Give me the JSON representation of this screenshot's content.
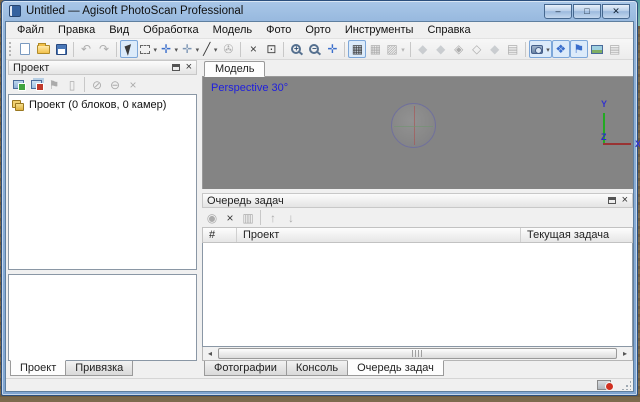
{
  "window": {
    "title": "Untitled — Agisoft PhotoScan Professional",
    "controls": {
      "minimize": "–",
      "maximize": "□",
      "close": "✕"
    }
  },
  "menu": {
    "items": [
      {
        "name": "menu-file",
        "label": "Файл"
      },
      {
        "name": "menu-edit",
        "label": "Правка"
      },
      {
        "name": "menu-view",
        "label": "Вид"
      },
      {
        "name": "menu-workflow",
        "label": "Обработка"
      },
      {
        "name": "menu-model",
        "label": "Модель"
      },
      {
        "name": "menu-photo",
        "label": "Фото"
      },
      {
        "name": "menu-ortho",
        "label": "Орто"
      },
      {
        "name": "menu-tools",
        "label": "Инструменты"
      },
      {
        "name": "menu-help",
        "label": "Справка"
      }
    ]
  },
  "toolbar": {
    "items": [
      {
        "name": "new-button",
        "icon": "new-document-icon",
        "cls": "i-page",
        "interactable": true
      },
      {
        "name": "open-button",
        "icon": "open-folder-icon",
        "cls": "i-folder",
        "interactable": true
      },
      {
        "name": "save-button",
        "icon": "save-floppy-icon",
        "cls": "i-floppy",
        "interactable": true
      },
      {
        "sep": true
      },
      {
        "name": "undo-button",
        "icon": "undo-icon",
        "glyph": "↶",
        "state": "disabled",
        "interactable": false
      },
      {
        "name": "redo-button",
        "icon": "redo-icon",
        "glyph": "↷",
        "state": "disabled",
        "interactable": false
      },
      {
        "sep": true
      },
      {
        "name": "navigation-button",
        "icon": "cursor-arrow-icon",
        "cls": "i-cursor",
        "state": "active",
        "interactable": true
      },
      {
        "name": "rectangle-selection-button",
        "icon": "rectangle-selection-icon",
        "cls": "i-rectsel",
        "drop": true,
        "interactable": true
      },
      {
        "name": "move-object-button",
        "icon": "move-arrows-icon",
        "glyph": "✛",
        "cls": "c-blue",
        "drop": true,
        "interactable": true
      },
      {
        "name": "rotate-object-button",
        "icon": "rotate-arrows-icon",
        "glyph": "✛",
        "cls": "c-steel",
        "drop": true,
        "interactable": true
      },
      {
        "name": "ruler-button",
        "icon": "ruler-icon",
        "glyph": "╱",
        "drop": true,
        "interactable": true
      },
      {
        "name": "attach-button",
        "icon": "paperclip-icon",
        "glyph": "✇",
        "state": "disabled",
        "interactable": false
      },
      {
        "sep": true
      },
      {
        "name": "delete-button",
        "icon": "delete-x-icon",
        "glyph": "×",
        "interactable": true
      },
      {
        "name": "crop-button",
        "icon": "crop-icon",
        "glyph": "⊡",
        "interactable": true
      },
      {
        "sep": true
      },
      {
        "name": "zoom-in-button",
        "icon": "zoom-in-icon",
        "cls": "i-mag",
        "glyph": "+",
        "interactable": true
      },
      {
        "name": "zoom-out-button",
        "icon": "zoom-out-icon",
        "cls": "i-mag",
        "glyph": "−",
        "interactable": true
      },
      {
        "name": "zoom-fit-button",
        "icon": "zoom-fit-icon",
        "glyph": "✛",
        "cls": "c-blue",
        "interactable": true
      },
      {
        "sep": true
      },
      {
        "name": "grid-view-button",
        "icon": "grid-view-icon",
        "glyph": "▦",
        "cls": "c-dark",
        "state": "active",
        "interactable": true
      },
      {
        "name": "grid-view-large-button",
        "icon": "grid-view-large-icon",
        "glyph": "▦",
        "state": "disabled",
        "interactable": false
      },
      {
        "name": "tile-view-button",
        "icon": "tile-view-icon",
        "glyph": "▨",
        "state": "disabled",
        "drop": true,
        "interactable": false
      },
      {
        "sep": true
      },
      {
        "name": "point-cloud-view-button",
        "icon": "point-cloud-diamond-icon",
        "glyph": "◆",
        "cls": "c-steel",
        "state": "disabled",
        "interactable": false
      },
      {
        "name": "shaded-view-button",
        "icon": "shaded-diamond-icon",
        "glyph": "◆",
        "cls": "c-steel",
        "state": "disabled",
        "interactable": false
      },
      {
        "name": "solid-view-button",
        "icon": "solid-diamond-icon",
        "glyph": "◈",
        "state": "disabled",
        "interactable": false
      },
      {
        "name": "wireframe-view-button",
        "icon": "wireframe-diamond-icon",
        "glyph": "◇",
        "state": "disabled",
        "interactable": false
      },
      {
        "name": "textured-view-button",
        "icon": "textured-diamond-icon",
        "glyph": "◆",
        "cls": "c-steel",
        "state": "disabled",
        "interactable": false
      },
      {
        "name": "show-cameras-button",
        "icon": "camera-rig-icon",
        "glyph": "▤",
        "state": "disabled",
        "interactable": false
      },
      {
        "sep": true
      },
      {
        "name": "show-photos-button",
        "icon": "camera-icon",
        "cls": "i-cam",
        "state": "active",
        "drop": true,
        "interactable": true
      },
      {
        "name": "show-markers-button",
        "icon": "marker-tag-icon",
        "glyph": "❖",
        "cls": "c-blue",
        "state": "active",
        "interactable": true
      },
      {
        "name": "show-flags-button",
        "icon": "flag-icon",
        "glyph": "⚑",
        "cls": "c-blue",
        "state": "active",
        "interactable": true
      },
      {
        "name": "ortho-view-button",
        "icon": "ortho-image-icon",
        "cls": "i-img",
        "interactable": true
      },
      {
        "name": "layers-button",
        "icon": "layers-icon",
        "glyph": "▤",
        "state": "disabled",
        "interactable": false
      }
    ]
  },
  "workspace_panel": {
    "title": "Проект",
    "toolbar": [
      {
        "name": "add-chunk-button",
        "icon": "add-chunk-icon",
        "cls": "i-addimg",
        "interactable": true
      },
      {
        "name": "add-photos-button",
        "icon": "add-photos-icon",
        "cls": "i-addimgs",
        "interactable": true
      },
      {
        "name": "add-marker-button",
        "icon": "add-marker-icon",
        "glyph": "⚑",
        "state": "disabled",
        "interactable": false
      },
      {
        "name": "add-scalebar-button",
        "icon": "add-scalebar-icon",
        "glyph": "▯",
        "state": "disabled",
        "interactable": false
      },
      {
        "sep": true
      },
      {
        "name": "enable-item-button",
        "icon": "enable-circle-icon",
        "glyph": "⊘",
        "state": "disabled",
        "interactable": false
      },
      {
        "name": "disable-item-button",
        "icon": "disable-circle-icon",
        "glyph": "⊖",
        "state": "disabled",
        "interactable": false
      },
      {
        "name": "remove-item-button",
        "icon": "remove-x-icon",
        "glyph": "×",
        "state": "disabled",
        "interactable": false
      }
    ],
    "tree_root": "Проект (0 блоков, 0 камер)",
    "tabs": [
      {
        "name": "tab-workspace",
        "label": "Проект",
        "state": "active",
        "interactable": true
      },
      {
        "name": "tab-reference",
        "label": "Привязка",
        "interactable": true
      }
    ]
  },
  "model_view": {
    "tab": "Модель",
    "overlay": "Perspective 30°",
    "axis": {
      "x": "X",
      "y": "Y",
      "z": "Z"
    }
  },
  "task_queue": {
    "title": "Очередь задач",
    "toolbar": [
      {
        "name": "run-tasks-button",
        "icon": "run-record-icon",
        "glyph": "◉",
        "state": "disabled",
        "interactable": false
      },
      {
        "name": "delete-task-button",
        "icon": "delete-x-icon",
        "glyph": "×",
        "interactable": true
      },
      {
        "name": "export-tasks-button",
        "icon": "export-batch-icon",
        "glyph": "▥",
        "state": "disabled",
        "interactable": false
      },
      {
        "sep": true
      },
      {
        "name": "move-task-up-button",
        "icon": "arrow-up-icon",
        "glyph": "↑",
        "state": "disabled",
        "interactable": false
      },
      {
        "name": "move-task-down-button",
        "icon": "arrow-down-icon",
        "glyph": "↓",
        "state": "disabled",
        "interactable": false
      }
    ],
    "columns": [
      "#",
      "Проект",
      "Текущая задача"
    ],
    "rows": [],
    "tabs": [
      {
        "name": "tab-photos",
        "label": "Фотографии",
        "interactable": true
      },
      {
        "name": "tab-console",
        "label": "Консоль",
        "interactable": true
      },
      {
        "name": "tab-task-queue",
        "label": "Очередь задач",
        "state": "active",
        "interactable": true
      }
    ]
  },
  "colors": {
    "titlebar_blue": "#8fb2da",
    "viewport_gray": "#848484",
    "overlay_blue": "#2020dd",
    "axis_green": "#22aa22",
    "axis_red": "#993333",
    "status_red": "#d03020"
  }
}
